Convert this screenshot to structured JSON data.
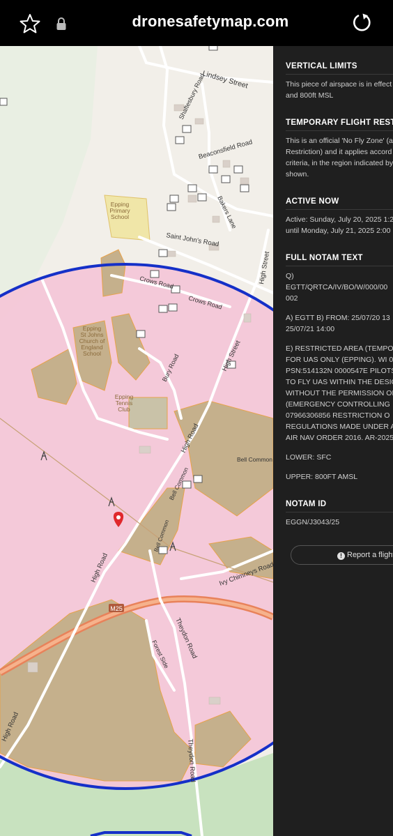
{
  "browser": {
    "url": "dronesafetymap.com",
    "icons": [
      "star-icon",
      "lock-icon",
      "reload-icon"
    ]
  },
  "map": {
    "streets": [
      "Lindsey Street",
      "Shaftesbury Road",
      "Beaconsfield Road",
      "Bakers Lane",
      "Saint John's Road",
      "High Street",
      "Crows Road",
      "Crows Road",
      "Bury Road",
      "High Street",
      "High Road",
      "Bell Common",
      "Bell Common",
      "High Road",
      "Bell Common",
      "Ivy Chimneys Road",
      "Theydon Road",
      "Forest Side",
      "High Road",
      "Theydon Road"
    ],
    "places": [
      "Epping Primary School",
      "Epping St Johns Church of England School",
      "Epping Tennis Club"
    ],
    "poi_lines": [
      [
        "Epping",
        "Primary",
        "School"
      ],
      [
        "Epping",
        "St Johns",
        "Church of",
        "England",
        "School"
      ],
      [
        "Epping",
        "Tennis",
        "Club"
      ]
    ],
    "road_shield": "M25",
    "colors": {
      "restriction_fill": "#f4c6d7",
      "restriction_border": "#1530c8",
      "woodland": "#c5b08c",
      "marker": "#e0282c"
    }
  },
  "panel": {
    "sections": [
      {
        "title": "VERTICAL LIMITS",
        "lines": [
          "This piece of airspace is in effect",
          "and 800ft MSL"
        ]
      },
      {
        "title": "TEMPORARY FLIGHT RESTRIC",
        "lines": [
          "This is an official 'No Fly Zone' (a",
          "Restriction) and it applies accord",
          "criteria, in the region indicated by",
          "shown."
        ]
      },
      {
        "title": "ACTIVE NOW",
        "lines": [
          "Active: Sunday, July 20, 2025 1:2",
          "until Monday, July 21, 2025 2:00"
        ]
      },
      {
        "title": "FULL NOTAM TEXT",
        "lines": [
          "Q)",
          "EGTT/QRTCA/IV/BO/W/000/00",
          "002",
          "",
          "A) EGTT B) FROM: 25/07/20 13",
          "25/07/21 14:00",
          "",
          "E) RESTRICTED AREA (TEMPO",
          "FOR UAS ONLY (EPPING). WI 0.",
          "PSN:514132N 0000547E PILOTS",
          "TO FLY UAS WITHIN THE DESIG",
          "WITHOUT THE PERMISSION OF",
          "(EMERGENCY CONTROLLING",
          "07966306856 RESTRICTION O",
          "REGULATIONS MADE UNDER A",
          "AIR NAV ORDER 2016. AR-2025",
          "",
          "LOWER: SFC",
          "",
          "UPPER: 800FT AMSL"
        ]
      },
      {
        "title": "NOTAM ID",
        "lines": [
          "EGGN/J3043/25"
        ]
      }
    ],
    "report_button": "Report a flight"
  }
}
